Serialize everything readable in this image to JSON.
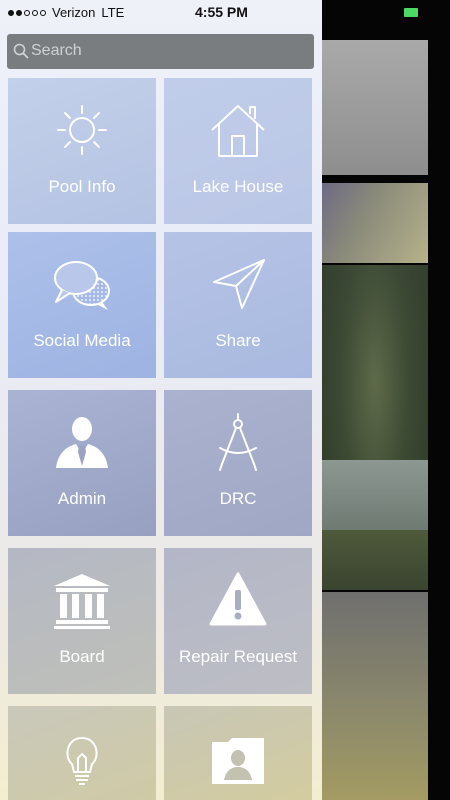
{
  "status_bar": {
    "carrier": "Verizon",
    "network": "LTE",
    "time": "4:55 PM",
    "signal_bars_filled": 2,
    "signal_bars_total": 5,
    "battery_color": "#4cd964"
  },
  "search": {
    "placeholder": "Search",
    "icon": "search-icon"
  },
  "menu": {
    "items": [
      {
        "label": "Pool Info",
        "icon": "sun-icon"
      },
      {
        "label": "Lake House",
        "icon": "house-icon"
      },
      {
        "label": "Social Media",
        "icon": "chat-bubbles-icon"
      },
      {
        "label": "Share",
        "icon": "paper-plane-icon"
      },
      {
        "label": "Admin",
        "icon": "businessman-icon"
      },
      {
        "label": "DRC",
        "icon": "drafting-compass-icon"
      },
      {
        "label": "Board",
        "icon": "bank-building-icon"
      },
      {
        "label": "Repair Request",
        "icon": "warning-icon"
      },
      {
        "label": "",
        "icon": "lightbulb-icon"
      },
      {
        "label": "",
        "icon": "contact-folder-icon"
      }
    ]
  }
}
